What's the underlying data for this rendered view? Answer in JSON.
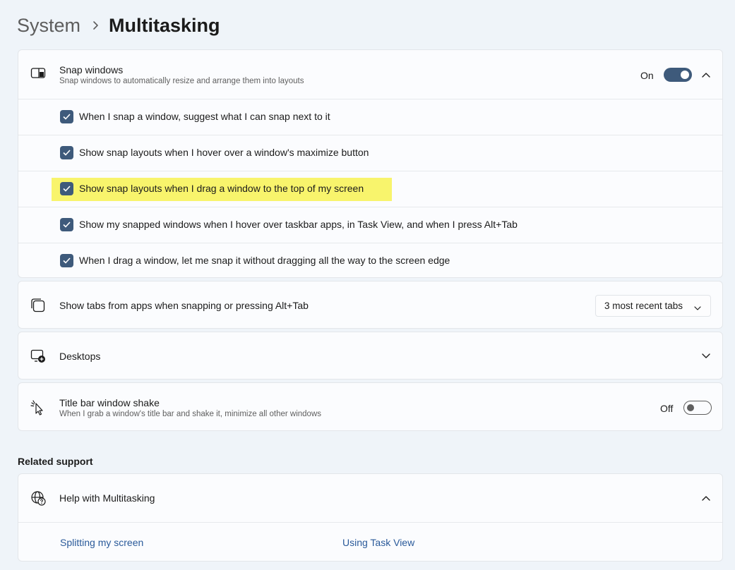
{
  "breadcrumb": {
    "parent": "System",
    "current": "Multitasking"
  },
  "snap": {
    "title": "Snap windows",
    "desc": "Snap windows to automatically resize and arrange them into layouts",
    "state": "On",
    "options": [
      {
        "label": "When I snap a window, suggest what I can snap next to it",
        "checked": true
      },
      {
        "label": "Show snap layouts when I hover over a window's maximize button",
        "checked": true
      },
      {
        "label": "Show snap layouts when I drag a window to the top of my screen",
        "checked": true,
        "highlighted": true
      },
      {
        "label": "Show my snapped windows when I hover over taskbar apps, in Task View, and when I press Alt+Tab",
        "checked": true
      },
      {
        "label": "When I drag a window, let me snap it without dragging all the way to the screen edge",
        "checked": true
      }
    ]
  },
  "tabs": {
    "title": "Show tabs from apps when snapping or pressing Alt+Tab",
    "selected": "3 most recent tabs"
  },
  "desktops": {
    "title": "Desktops"
  },
  "shake": {
    "title": "Title bar window shake",
    "desc": "When I grab a window's title bar and shake it, minimize all other windows",
    "state": "Off"
  },
  "related": {
    "label": "Related support",
    "help_title": "Help with Multitasking",
    "links": [
      "Splitting my screen",
      "Using Task View"
    ]
  },
  "colors": {
    "accent": "#3e5a7b",
    "highlight": "#f8f46c",
    "link": "#2a5a9a"
  },
  "icons": [
    "snap-windows-icon",
    "tabs-icon",
    "desktops-icon",
    "shake-icon",
    "help-globe-icon"
  ]
}
